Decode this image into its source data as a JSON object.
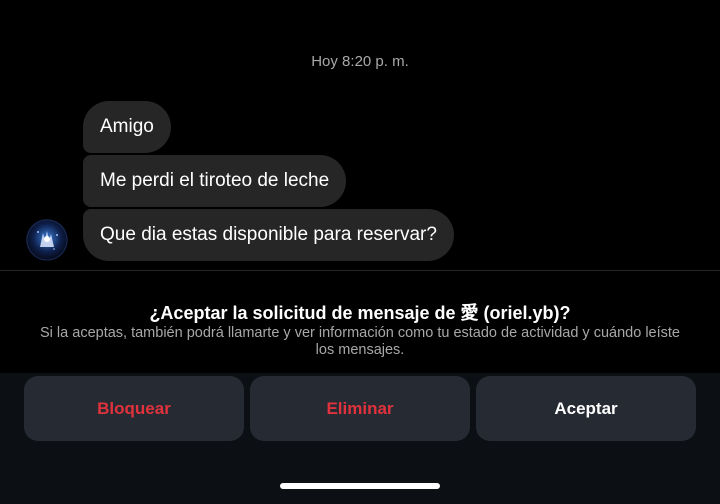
{
  "chat": {
    "timestamp": "Hoy 8:20 p. m.",
    "messages": [
      {
        "text": "Amigo"
      },
      {
        "text": "Me perdi el tiroteo de leche"
      },
      {
        "text": "Que dia estas disponible para reservar?"
      }
    ],
    "avatar_icon": "profile-avatar"
  },
  "request": {
    "title": "¿Aceptar la solicitud de mensaje de 愛 (oriel.yb)?",
    "description": "Si la aceptas, también podrá llamarte y ver información como tu estado de actividad y cuándo leíste los mensajes."
  },
  "actions": {
    "block_label": "Bloquear",
    "delete_label": "Eliminar",
    "accept_label": "Aceptar"
  },
  "colors": {
    "background": "#000000",
    "bubble": "#262626",
    "destructive": "#e0323c",
    "button_bg": "#262a33",
    "secondary_text": "#a8a8a8"
  }
}
